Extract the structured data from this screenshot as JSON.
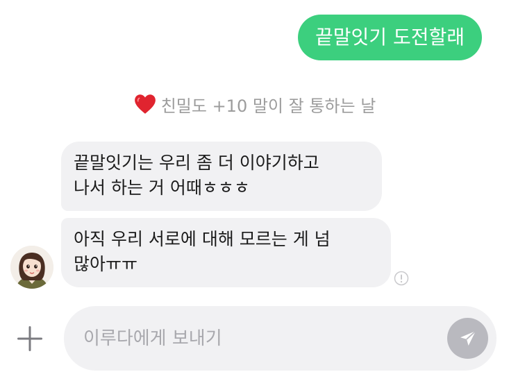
{
  "messages": {
    "outgoing": {
      "text": "끝말잇기 도전할래"
    },
    "notice": {
      "icon": "heart-icon",
      "text": "친밀도 +10 말이 잘 통하는 날"
    },
    "incoming": [
      {
        "lines": [
          "끝말잇기는 우리 좀 더 이야기하고",
          "나서 하는 거 어때ㅎㅎㅎ"
        ]
      },
      {
        "lines": [
          "아직 우리 서로에 대해 모르는 게 넘",
          "많아ㅠㅠ"
        ]
      }
    ]
  },
  "composer": {
    "placeholder": "이루다에게 보내기",
    "value": "",
    "plus_icon": "plus-icon",
    "send_icon": "send-icon"
  },
  "colors": {
    "outgoing_bubble": "#3ccf7e",
    "incoming_bubble": "#f1f1f3",
    "notice_text": "#9c9c9c",
    "send_button": "#b9b9bf",
    "heart": "#e0242f"
  }
}
